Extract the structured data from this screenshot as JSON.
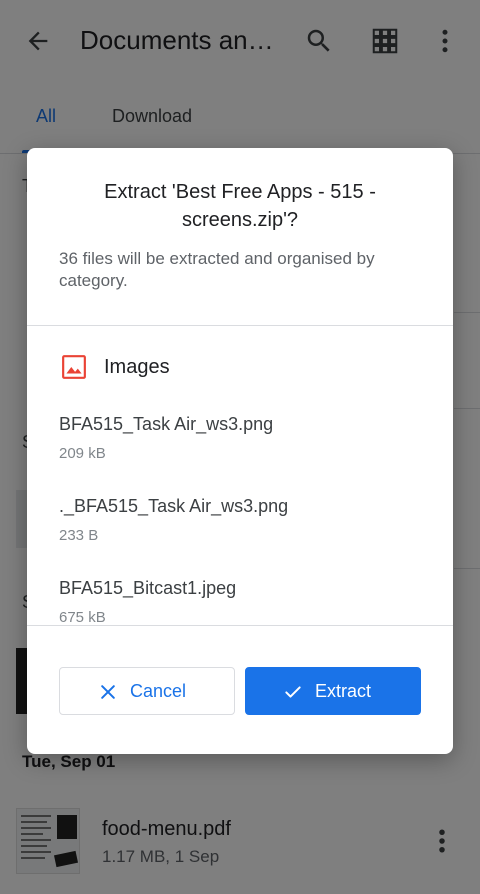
{
  "appbar": {
    "title": "Documents an…",
    "icons": [
      "back-arrow-icon",
      "search-icon",
      "grid-view-icon",
      "more-vert-icon"
    ]
  },
  "tabs": [
    {
      "label": "All",
      "active": true
    },
    {
      "label": "Download",
      "active": false
    }
  ],
  "background": {
    "partial_letters": [
      "T",
      "S",
      "S"
    ],
    "section_date": "Tue, Sep 01",
    "file": {
      "name": "food-menu.pdf",
      "meta": "1.17 MB, 1 Sep"
    }
  },
  "dialog": {
    "title": "Extract 'Best Free Apps - 515 - screens.zip'?",
    "description": "36 files will be extracted and organised by category.",
    "category": {
      "label": "Images",
      "icon": "image-icon",
      "icon_color": "#ea4335"
    },
    "items": [
      {
        "name": "BFA515_Task Air_ws3.png",
        "size": "209 kB"
      },
      {
        "name": "._BFA515_Task Air_ws3.png",
        "size": "233 B"
      },
      {
        "name": "BFA515_Bitcast1.jpeg",
        "size": "675 kB"
      }
    ],
    "cancel_label": "Cancel",
    "extract_label": "Extract",
    "accent_color": "#1a73e8"
  }
}
